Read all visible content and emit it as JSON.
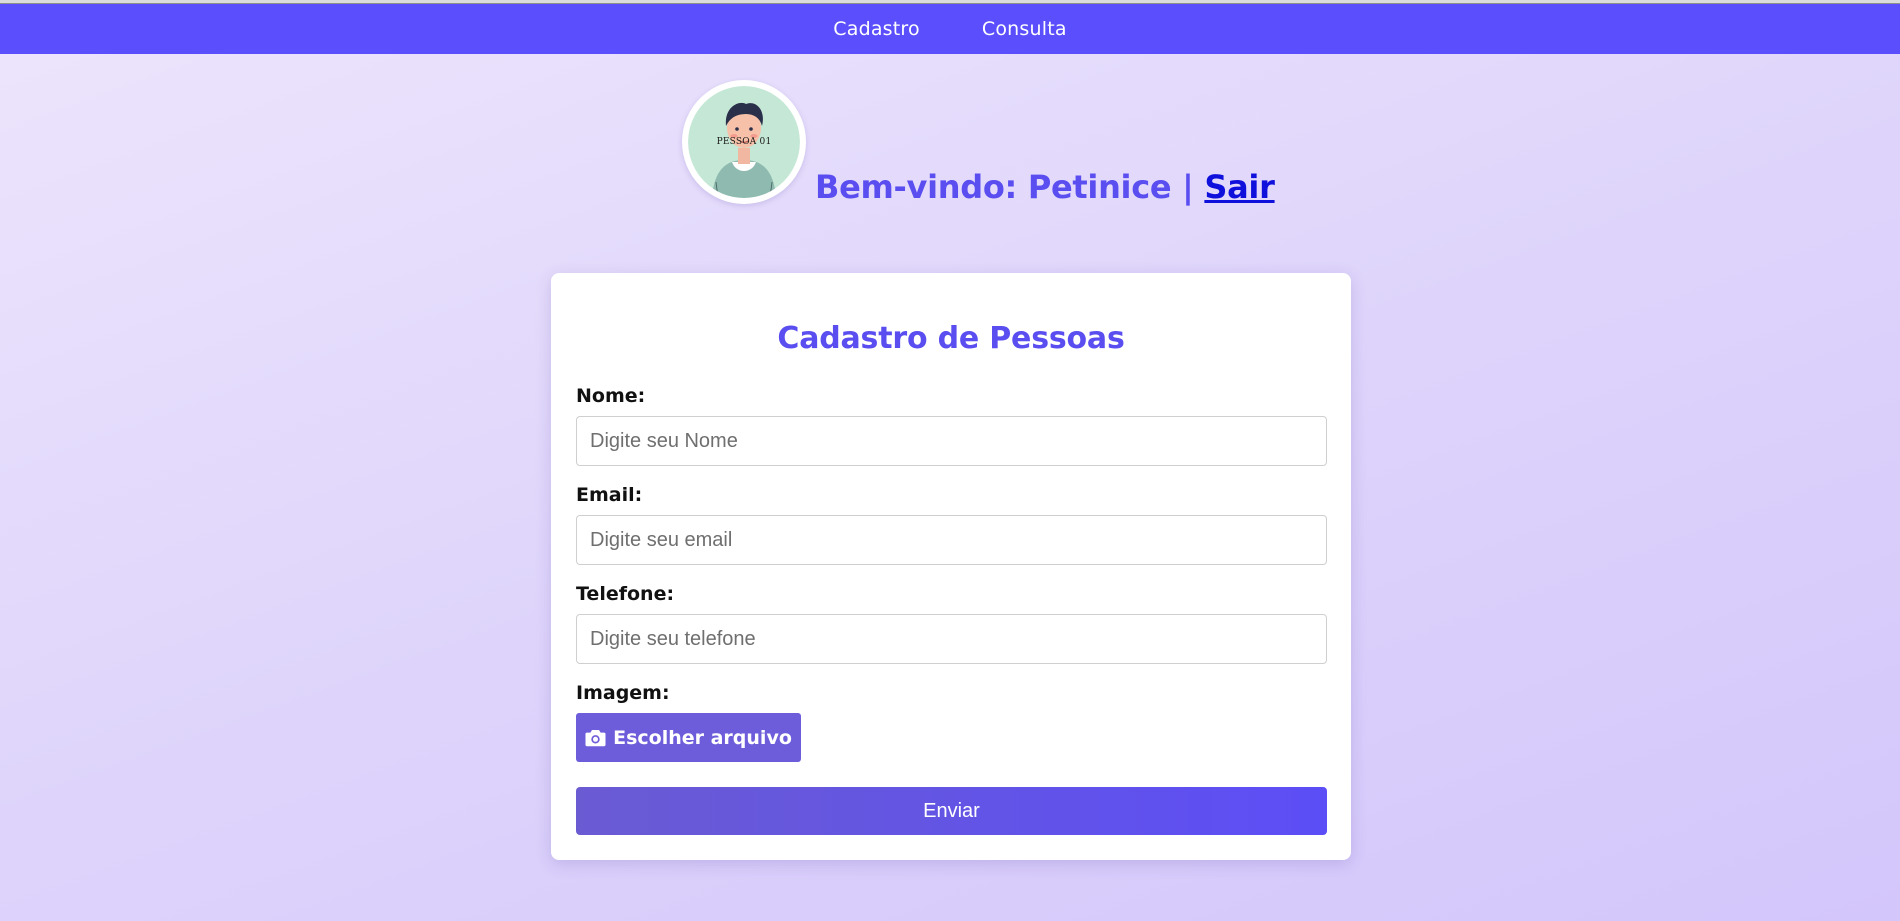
{
  "nav": {
    "items": [
      {
        "label": "Cadastro"
      },
      {
        "label": "Consulta"
      }
    ]
  },
  "avatar": {
    "caption": "PESSOA 01"
  },
  "welcome": {
    "prefix": "Bem-vindo: Petinice | ",
    "logout_label": "Sair"
  },
  "form": {
    "title": "Cadastro de Pessoas",
    "name": {
      "label": "Nome:",
      "placeholder": "Digite seu Nome",
      "value": ""
    },
    "email": {
      "label": "Email:",
      "placeholder": "Digite seu email",
      "value": ""
    },
    "phone": {
      "label": "Telefone:",
      "placeholder": "Digite seu telefone",
      "value": ""
    },
    "image": {
      "label": "Imagem:",
      "button_label": "Escolher arquivo",
      "icon": "camera-icon"
    },
    "submit_label": "Enviar"
  },
  "colors": {
    "navbar": "#5b4ffd",
    "accent_text": "#5a4ef0",
    "link": "#1010dd",
    "file_button": "#6e5ddb",
    "submit_gradient_start": "#6a5bd3",
    "submit_gradient_end": "#5c4ef6"
  }
}
